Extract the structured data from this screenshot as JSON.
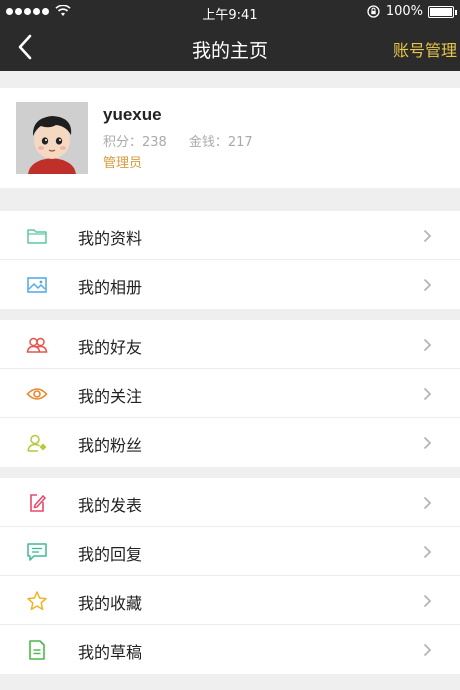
{
  "status_bar": {
    "time": "上午9:41",
    "battery": "100%"
  },
  "nav": {
    "title": "我的主页",
    "action_label": "账号管理"
  },
  "profile": {
    "username": "yuexue",
    "points_label": "积分：238",
    "money_label": "金钱：217",
    "role": "管理员"
  },
  "groups": [
    {
      "items": [
        {
          "label": "我的资料",
          "icon": "folder-icon",
          "color": "#5fc9a1"
        },
        {
          "label": "我的相册",
          "icon": "photo-icon",
          "color": "#4da9e3"
        }
      ]
    },
    {
      "items": [
        {
          "label": "我的好友",
          "icon": "friends-icon",
          "color": "#e8534d"
        },
        {
          "label": "我的关注",
          "icon": "eye-icon",
          "color": "#e8862b"
        },
        {
          "label": "我的粉丝",
          "icon": "fans-icon",
          "color": "#b6c93a"
        }
      ]
    },
    {
      "items": [
        {
          "label": "我的发表",
          "icon": "compose-icon",
          "color": "#e8496a"
        },
        {
          "label": "我的回复",
          "icon": "reply-icon",
          "color": "#3dbb95"
        },
        {
          "label": "我的收藏",
          "icon": "star-icon",
          "color": "#f0b323"
        },
        {
          "label": "我的草稿",
          "icon": "draft-icon",
          "color": "#4cb94a"
        }
      ]
    }
  ],
  "colors": {
    "header_bg": "#2b2b2b",
    "accent": "#e8c64a",
    "role": "#d99a3d"
  }
}
